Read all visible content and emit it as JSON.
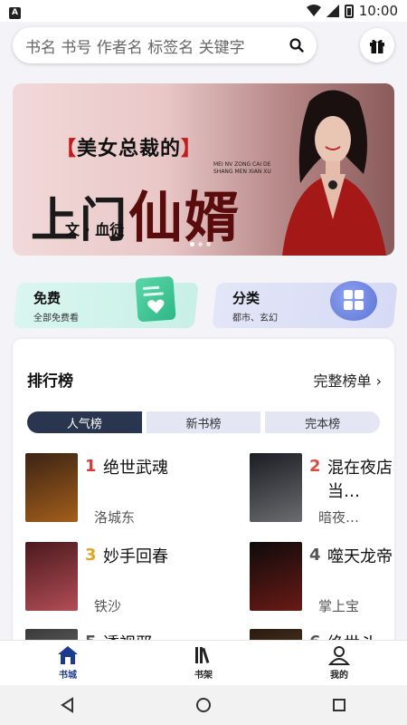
{
  "status_bar": {
    "app_notification": "A",
    "time": "10:00"
  },
  "search": {
    "placeholder": "书名 书号 作者名 标签名 关键字"
  },
  "banner": {
    "tag_open": "【",
    "tag_text": "美女总裁的",
    "tag_close": "】",
    "pinyin": "MEI NV ZONG CAI DE SHANG MEN XIAN XU",
    "title_part1": "上门",
    "title_part2": "仙婿",
    "author": "文 · 血徒",
    "active_dot": 0
  },
  "quick_links": [
    {
      "title": "免费",
      "subtitle": "全部免费看"
    },
    {
      "title": "分类",
      "subtitle": "都市、玄幻"
    }
  ],
  "ranking": {
    "title": "排行榜",
    "more_label": "完整榜单 ›",
    "tabs": [
      "人气榜",
      "新书榜",
      "完本榜"
    ],
    "active_tab": 0,
    "books": [
      {
        "rank": "1",
        "title": "绝世武魂",
        "author": "洛城东",
        "rank_color": "#d63b3b",
        "cover_colors": [
          "#3b2414",
          "#a45e1b"
        ]
      },
      {
        "rank": "2",
        "title": "混在夜店当…",
        "author": "暗夜…",
        "rank_color": "#e04a3a",
        "cover_colors": [
          "#1b1d22",
          "#6b6c70"
        ]
      },
      {
        "rank": "3",
        "title": "妙手回春",
        "author": "铁沙",
        "rank_color": "#e2a51f",
        "cover_colors": [
          "#4a1a1e",
          "#b34c55"
        ]
      },
      {
        "rank": "4",
        "title": "噬天龙帝",
        "author": "掌上宝",
        "rank_color": "#555555",
        "cover_colors": [
          "#0e0b0b",
          "#6a1a15"
        ]
      },
      {
        "rank": "5",
        "title": "透视邪…",
        "author": "",
        "rank_color": "#555555",
        "cover_colors": [
          "#3a3a3a",
          "#7a7a7a"
        ]
      },
      {
        "rank": "6",
        "title": "绝世斗…",
        "author": "",
        "rank_color": "#555555",
        "cover_colors": [
          "#2a1a10",
          "#6a4a2a"
        ]
      }
    ]
  },
  "bottom_nav": [
    {
      "label": "书城",
      "icon": "home-icon"
    },
    {
      "label": "书架",
      "icon": "bookshelf-icon"
    },
    {
      "label": "我的",
      "icon": "profile-icon"
    }
  ],
  "bottom_nav_active": 0,
  "colors": {
    "accent": "#1d3b8e",
    "tab_active": "#2a3550",
    "tab_inactive": "#e4e6f4"
  }
}
